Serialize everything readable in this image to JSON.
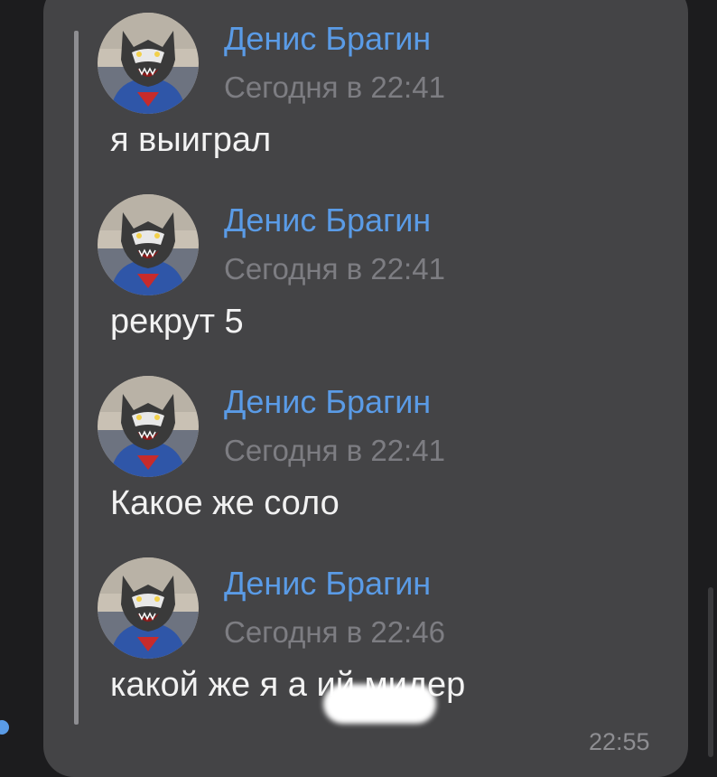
{
  "messages": [
    {
      "author": "Денис Брагин",
      "time": "Сегодня в 22:41",
      "text": "я выиграл"
    },
    {
      "author": "Денис Брагин",
      "time": "Сегодня в 22:41",
      "text": "рекрут 5"
    },
    {
      "author": "Денис Брагин",
      "time": "Сегодня в 22:41",
      "text": "Какое же соло"
    },
    {
      "author": "Денис Брагин",
      "time": "Сегодня в 22:46",
      "text": "какой же я а          ий мидер"
    }
  ],
  "bubble": {
    "sent_time": "22:55"
  },
  "colors": {
    "author": "#5a9be6",
    "bubble": "#444446",
    "background": "#1c1c1e",
    "unread_dot": "#5a9be6"
  }
}
